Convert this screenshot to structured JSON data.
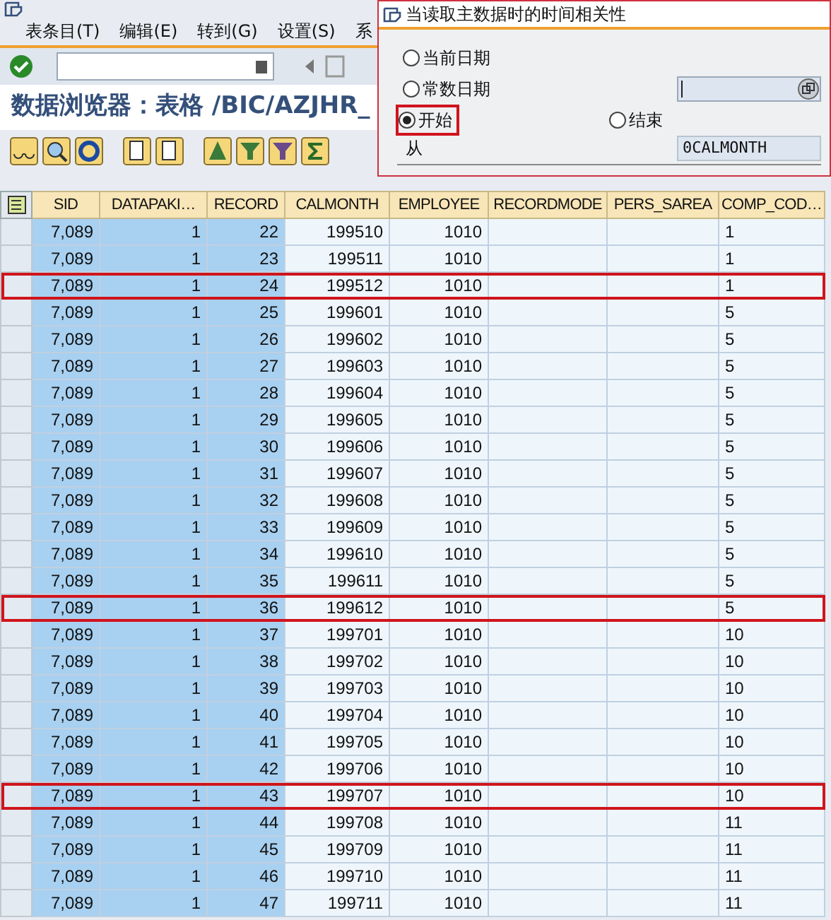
{
  "menu": [
    "表条目(T)",
    "编辑(E)",
    "转到(G)",
    "设置(S)",
    "系"
  ],
  "title": "数据浏览器：表格 /BIC/AZJHR_",
  "dialog": {
    "title": "当读取主数据时的时间相关性",
    "options": [
      {
        "label": "当前日期",
        "selected": false
      },
      {
        "label": "常数日期",
        "selected": false
      },
      {
        "label": "开始",
        "selected": true
      },
      {
        "label": "结束",
        "selected": false
      }
    ],
    "from_label": "从",
    "from_value": "0CALMONTH"
  },
  "table": {
    "columns": [
      {
        "label": "SID",
        "key": true
      },
      {
        "label": "DATAPAKI…",
        "key": true
      },
      {
        "label": "RECORD",
        "key": true
      },
      {
        "label": "CALMONTH",
        "key": false
      },
      {
        "label": "EMPLOYEE",
        "key": false
      },
      {
        "label": "RECORDMODE",
        "key": false
      },
      {
        "label": "PERS_SAREA",
        "key": false
      },
      {
        "label": "COMP_COD…",
        "key": false
      }
    ],
    "rows": [
      {
        "cells": [
          "7,089",
          "1",
          "22",
          "199510",
          "1010",
          "",
          "",
          "1"
        ],
        "highlighted": false
      },
      {
        "cells": [
          "7,089",
          "1",
          "23",
          "199511",
          "1010",
          "",
          "",
          "1"
        ],
        "highlighted": false
      },
      {
        "cells": [
          "7,089",
          "1",
          "24",
          "199512",
          "1010",
          "",
          "",
          "1"
        ],
        "highlighted": true
      },
      {
        "cells": [
          "7,089",
          "1",
          "25",
          "199601",
          "1010",
          "",
          "",
          "5"
        ],
        "highlighted": false
      },
      {
        "cells": [
          "7,089",
          "1",
          "26",
          "199602",
          "1010",
          "",
          "",
          "5"
        ],
        "highlighted": false
      },
      {
        "cells": [
          "7,089",
          "1",
          "27",
          "199603",
          "1010",
          "",
          "",
          "5"
        ],
        "highlighted": false
      },
      {
        "cells": [
          "7,089",
          "1",
          "28",
          "199604",
          "1010",
          "",
          "",
          "5"
        ],
        "highlighted": false
      },
      {
        "cells": [
          "7,089",
          "1",
          "29",
          "199605",
          "1010",
          "",
          "",
          "5"
        ],
        "highlighted": false
      },
      {
        "cells": [
          "7,089",
          "1",
          "30",
          "199606",
          "1010",
          "",
          "",
          "5"
        ],
        "highlighted": false
      },
      {
        "cells": [
          "7,089",
          "1",
          "31",
          "199607",
          "1010",
          "",
          "",
          "5"
        ],
        "highlighted": false
      },
      {
        "cells": [
          "7,089",
          "1",
          "32",
          "199608",
          "1010",
          "",
          "",
          "5"
        ],
        "highlighted": false
      },
      {
        "cells": [
          "7,089",
          "1",
          "33",
          "199609",
          "1010",
          "",
          "",
          "5"
        ],
        "highlighted": false
      },
      {
        "cells": [
          "7,089",
          "1",
          "34",
          "199610",
          "1010",
          "",
          "",
          "5"
        ],
        "highlighted": false
      },
      {
        "cells": [
          "7,089",
          "1",
          "35",
          "199611",
          "1010",
          "",
          "",
          "5"
        ],
        "highlighted": false
      },
      {
        "cells": [
          "7,089",
          "1",
          "36",
          "199612",
          "1010",
          "",
          "",
          "5"
        ],
        "highlighted": true
      },
      {
        "cells": [
          "7,089",
          "1",
          "37",
          "199701",
          "1010",
          "",
          "",
          "10"
        ],
        "highlighted": false
      },
      {
        "cells": [
          "7,089",
          "1",
          "38",
          "199702",
          "1010",
          "",
          "",
          "10"
        ],
        "highlighted": false
      },
      {
        "cells": [
          "7,089",
          "1",
          "39",
          "199703",
          "1010",
          "",
          "",
          "10"
        ],
        "highlighted": false
      },
      {
        "cells": [
          "7,089",
          "1",
          "40",
          "199704",
          "1010",
          "",
          "",
          "10"
        ],
        "highlighted": false
      },
      {
        "cells": [
          "7,089",
          "1",
          "41",
          "199705",
          "1010",
          "",
          "",
          "10"
        ],
        "highlighted": false
      },
      {
        "cells": [
          "7,089",
          "1",
          "42",
          "199706",
          "1010",
          "",
          "",
          "10"
        ],
        "highlighted": false
      },
      {
        "cells": [
          "7,089",
          "1",
          "43",
          "199707",
          "1010",
          "",
          "",
          "10"
        ],
        "highlighted": true
      },
      {
        "cells": [
          "7,089",
          "1",
          "44",
          "199708",
          "1010",
          "",
          "",
          "11"
        ],
        "highlighted": false
      },
      {
        "cells": [
          "7,089",
          "1",
          "45",
          "199709",
          "1010",
          "",
          "",
          "11"
        ],
        "highlighted": false
      },
      {
        "cells": [
          "7,089",
          "1",
          "46",
          "199710",
          "1010",
          "",
          "",
          "11"
        ],
        "highlighted": false
      },
      {
        "cells": [
          "7,089",
          "1",
          "47",
          "199711",
          "1010",
          "",
          "",
          "11"
        ],
        "highlighted": false
      }
    ]
  }
}
